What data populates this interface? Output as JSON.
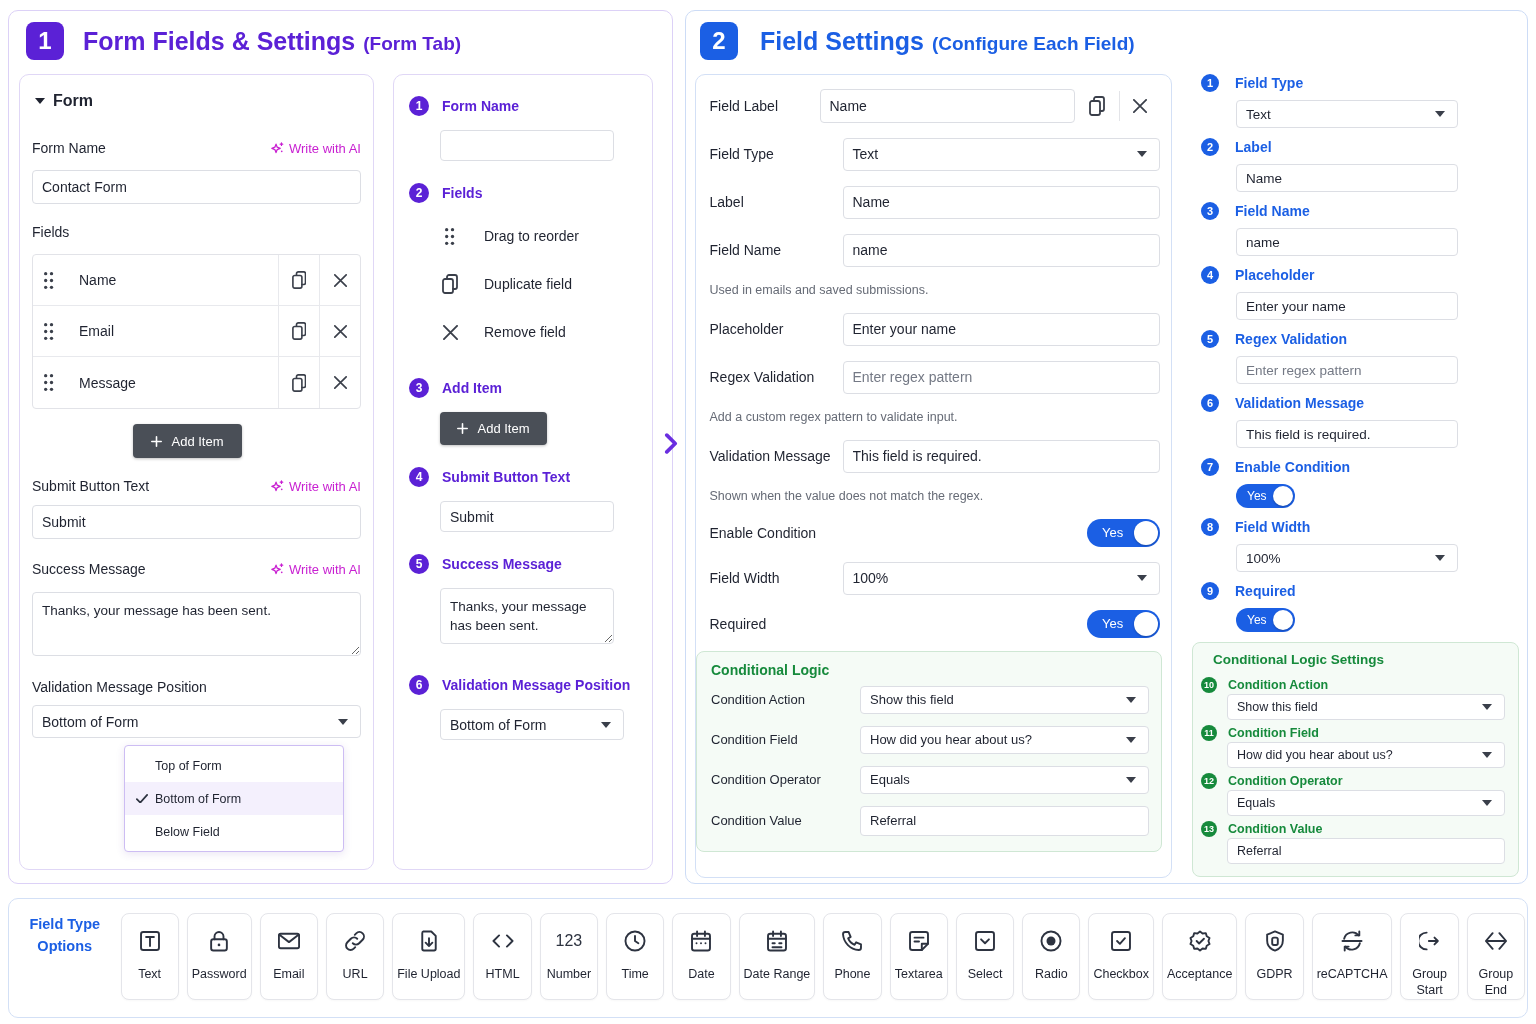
{
  "form_tab": {
    "step": "1",
    "title": "Form Fields & Settings",
    "subtitle": "(Form Tab)",
    "form_panel": {
      "heading": "Form",
      "expanded": true,
      "form_name": {
        "label": "Form Name",
        "ai_action": "Write with AI",
        "value": "Contact Form"
      },
      "fields_label": "Fields",
      "fields": [
        {
          "name": "Name"
        },
        {
          "name": "Email"
        },
        {
          "name": "Message"
        }
      ],
      "add_button": "Add Item",
      "submit_button_text": {
        "label": "Submit Button Text",
        "ai_action": "Write with AI",
        "value": "Submit"
      },
      "success_message": {
        "label": "Success Message",
        "ai_action": "Write with AI",
        "value": "Thanks, your message has been sent."
      },
      "validation_message_position": {
        "label": "Validation Message Position",
        "value": "Bottom of Form",
        "options": [
          {
            "label": "Top of Form",
            "selected": false
          },
          {
            "label": "Bottom of Form",
            "selected": true
          },
          {
            "label": "Below Field",
            "selected": false
          }
        ]
      }
    },
    "guide": [
      {
        "number": "1",
        "title": "Form Name",
        "kind": "input"
      },
      {
        "number": "2",
        "title": "Fields",
        "kind": "legend",
        "items": [
          {
            "kind": "drag",
            "text": "Drag to reorder"
          },
          {
            "kind": "duplicate",
            "text": "Duplicate field"
          },
          {
            "kind": "remove",
            "text": "Remove field"
          }
        ]
      },
      {
        "number": "3",
        "title": "Add Item",
        "kind": "button",
        "button": "Add Item"
      },
      {
        "number": "4",
        "title": "Submit Button Text",
        "kind": "input",
        "value": "Submit"
      },
      {
        "number": "5",
        "title": "Success Message",
        "kind": "textarea",
        "value": "Thanks, your message has been sent."
      },
      {
        "number": "6",
        "title": "Validation Message Position",
        "kind": "select",
        "value": "Bottom of Form"
      }
    ]
  },
  "field_settings": {
    "step": "2",
    "title": "Field Settings",
    "subtitle": "(Configure Each Field)",
    "editor": {
      "field_label": {
        "label": "Field Label",
        "value": "Name"
      },
      "rows": [
        {
          "kind": "select",
          "label": "Field Type",
          "value": "Text"
        },
        {
          "kind": "input",
          "label": "Label",
          "value": "Name"
        },
        {
          "kind": "input",
          "label": "Field Name",
          "value": "name",
          "help": "Used in emails and saved submissions."
        },
        {
          "kind": "input",
          "label": "Placeholder",
          "value": "Enter your name"
        },
        {
          "kind": "input",
          "label": "Regex Validation",
          "placeholder": "Enter regex pattern",
          "help": "Add a custom regex pattern to validate input."
        },
        {
          "kind": "input",
          "label": "Validation Message",
          "value": "This field is required.",
          "help": "Shown when the value does not match the regex."
        },
        {
          "kind": "toggle",
          "label": "Enable Condition",
          "on": true,
          "text": "Yes"
        },
        {
          "kind": "select",
          "label": "Field Width",
          "value": "100%"
        },
        {
          "kind": "toggle",
          "label": "Required",
          "on": true,
          "text": "Yes"
        }
      ],
      "conditional_logic": {
        "title": "Conditional Logic",
        "rows": [
          {
            "kind": "select",
            "label": "Condition Action",
            "value": "Show this field"
          },
          {
            "kind": "select",
            "label": "Condition Field",
            "value": "How did you hear about us?"
          },
          {
            "kind": "select",
            "label": "Condition Operator",
            "value": "Equals"
          },
          {
            "kind": "input",
            "label": "Condition Value",
            "value": "Referral"
          }
        ]
      }
    },
    "guide": {
      "steps": [
        {
          "number": "1",
          "title": "Field Type",
          "kind": "select",
          "value": "Text"
        },
        {
          "number": "2",
          "title": "Label",
          "kind": "input",
          "value": "Name"
        },
        {
          "number": "3",
          "title": "Field Name",
          "kind": "input",
          "value": "name"
        },
        {
          "number": "4",
          "title": "Placeholder",
          "kind": "input",
          "value": "Enter your name"
        },
        {
          "number": "5",
          "title": "Regex Validation",
          "kind": "input",
          "placeholder": "Enter regex pattern"
        },
        {
          "number": "6",
          "title": "Validation Message",
          "kind": "input",
          "value": "This field is required."
        },
        {
          "number": "7",
          "title": "Enable Condition",
          "kind": "toggle",
          "on": true,
          "text": "Yes"
        },
        {
          "number": "8",
          "title": "Field Width",
          "kind": "select",
          "value": "100%"
        },
        {
          "number": "9",
          "title": "Required",
          "kind": "toggle",
          "on": true,
          "text": "Yes"
        }
      ],
      "conditional_logic": {
        "title": "Conditional Logic Settings",
        "steps": [
          {
            "number": "10",
            "title": "Condition Action",
            "kind": "select",
            "value": "Show this field"
          },
          {
            "number": "11",
            "title": "Condition Field",
            "kind": "select",
            "value": "How did you hear about us?"
          },
          {
            "number": "12",
            "title": "Condition Operator",
            "kind": "select",
            "value": "Equals"
          },
          {
            "number": "13",
            "title": "Condition Value",
            "kind": "input",
            "value": "Referral"
          }
        ]
      }
    }
  },
  "field_type_options": {
    "title": "Field Type Options",
    "types": [
      {
        "kind": "text",
        "label": "Text"
      },
      {
        "kind": "password",
        "label": "Password"
      },
      {
        "kind": "email",
        "label": "Email"
      },
      {
        "kind": "url",
        "label": "URL"
      },
      {
        "kind": "upload",
        "label": "File Upload"
      },
      {
        "kind": "html",
        "label": "HTML"
      },
      {
        "kind": "number",
        "symbol": "123",
        "label": "Number"
      },
      {
        "kind": "time",
        "label": "Time"
      },
      {
        "kind": "date",
        "label": "Date"
      },
      {
        "kind": "daterange",
        "label": "Date Range"
      },
      {
        "kind": "phone",
        "label": "Phone"
      },
      {
        "kind": "textarea",
        "label": "Textarea"
      },
      {
        "kind": "select",
        "label": "Select"
      },
      {
        "kind": "radio",
        "label": "Radio"
      },
      {
        "kind": "checkbox",
        "label": "Checkbox"
      },
      {
        "kind": "acceptance",
        "label": "Acceptance"
      },
      {
        "kind": "gdpr",
        "label": "GDPR"
      },
      {
        "kind": "recaptcha",
        "label": "reCAPTCHA"
      },
      {
        "kind": "groupstart",
        "label": "Group Start"
      },
      {
        "kind": "groupend",
        "label": "Group End"
      }
    ]
  }
}
